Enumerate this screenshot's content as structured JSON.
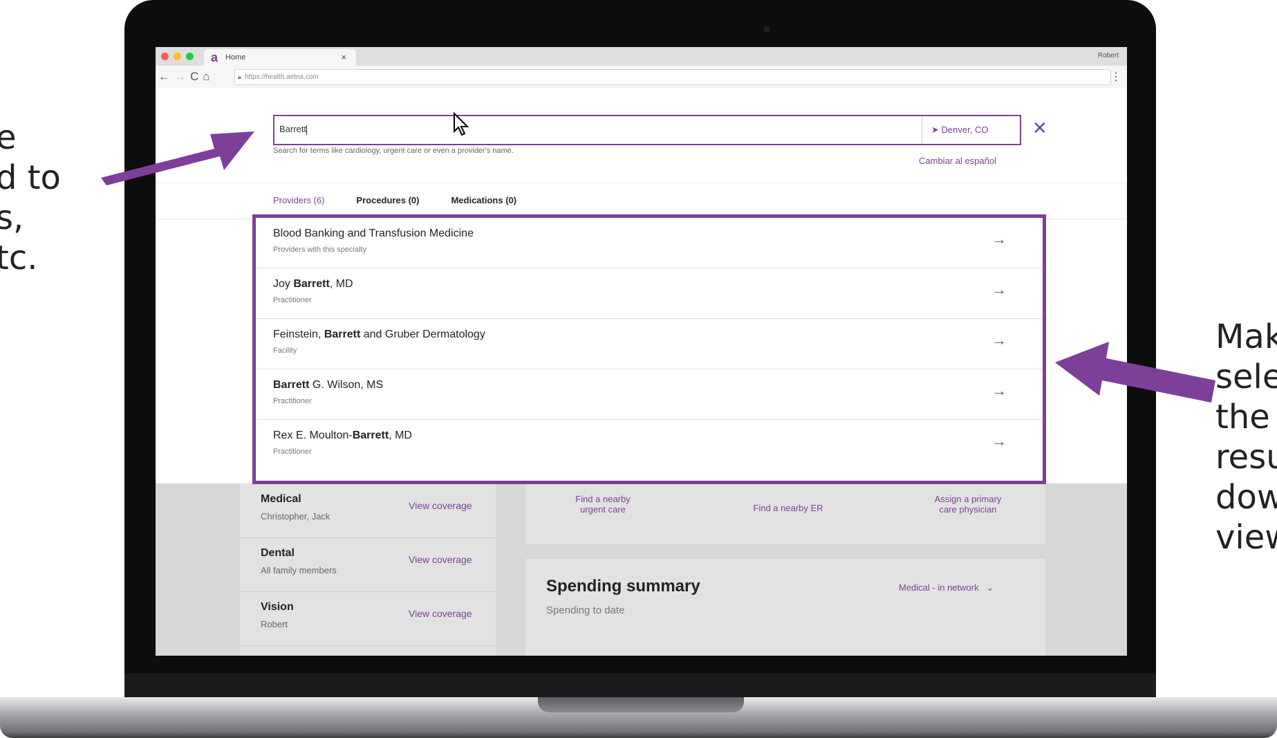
{
  "annotations": {
    "left_lines": [
      "e",
      "d to",
      "",
      "s,",
      "tc."
    ],
    "right_lines": [
      "Mak",
      "sele",
      "the",
      "resu",
      "dow",
      "view"
    ]
  },
  "browser": {
    "tab_title": "Home",
    "tab_logo": "a",
    "profile": "Robert",
    "url": "https://health.aetna.com"
  },
  "search": {
    "query": "Barrett",
    "location": "Denver, CO",
    "helper": "Search for terms like cardiology, urgent care or even a provider's name.",
    "language_link": "Cambiar al español"
  },
  "tabs": [
    {
      "label": "Providers (6)",
      "active": true
    },
    {
      "label": "Procedures (0)",
      "active": false
    },
    {
      "label": "Medications (0)",
      "active": false
    }
  ],
  "results": [
    {
      "pre": "Blood Banking and Transfusion Medicine",
      "bold": "",
      "post": "",
      "type": "Providers with this specialty"
    },
    {
      "pre": "Joy ",
      "bold": "Barrett",
      "post": ", MD",
      "type": "Practitioner"
    },
    {
      "pre": "Feinstein, ",
      "bold": "Barrett",
      "post": " and Gruber Dermatology",
      "type": "Facility"
    },
    {
      "pre": "",
      "bold": "Barrett",
      "post": " G. Wilson, MS",
      "type": "Practitioner"
    },
    {
      "pre": "Rex E. Moulton-",
      "bold": "Barrett",
      "post": ", MD",
      "type": "Practitioner"
    }
  ],
  "coverage": [
    {
      "name": "Medical",
      "who": "Christopher, Jack",
      "link": "View coverage"
    },
    {
      "name": "Dental",
      "who": "All family members",
      "link": "View coverage"
    },
    {
      "name": "Vision",
      "who": "Robert",
      "link": "View coverage"
    }
  ],
  "quick_actions": {
    "urgent_line1": "Find a nearby",
    "urgent_line2": "urgent care",
    "er": "Find a nearby ER",
    "pcp_line1": "Assign a primary",
    "pcp_line2": "care physician"
  },
  "spending": {
    "title": "Spending summary",
    "subtitle": "Spending to date",
    "selector": "Medical - in network"
  },
  "colors": {
    "accent": "#7d3f98"
  }
}
